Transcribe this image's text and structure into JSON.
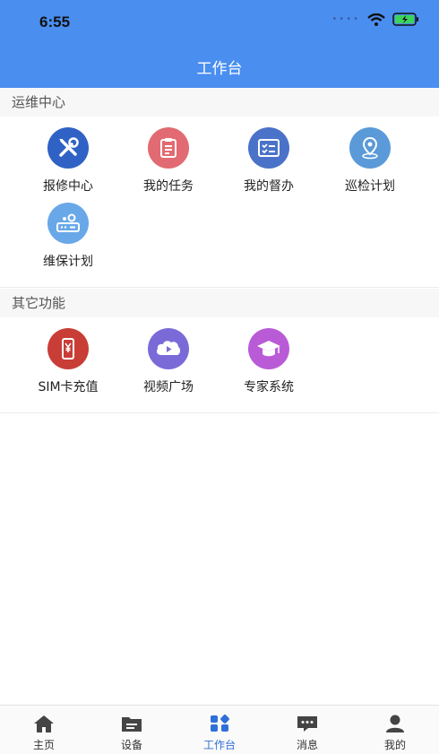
{
  "status_bar": {
    "time": "6:55"
  },
  "header": {
    "title": "工作台"
  },
  "sections": [
    {
      "title": "运维中心",
      "items": [
        {
          "label": "报修中心",
          "icon": "tools-icon",
          "color": "#2f62c4"
        },
        {
          "label": "我的任务",
          "icon": "clipboard-icon",
          "color": "#e26a72"
        },
        {
          "label": "我的督办",
          "icon": "checklist-icon",
          "color": "#4a72c8"
        },
        {
          "label": "巡检计划",
          "icon": "location-pin-icon",
          "color": "#5a9ad8"
        },
        {
          "label": "维保计划",
          "icon": "router-gear-icon",
          "color": "#69a8e8"
        }
      ]
    },
    {
      "title": "其它功能",
      "items": [
        {
          "label": "SIM卡充值",
          "icon": "phone-yuan-icon",
          "color": "#c83d36"
        },
        {
          "label": "视频广场",
          "icon": "video-play-icon",
          "color": "#7a6ad8"
        },
        {
          "label": "专家系统",
          "icon": "graduation-cap-icon",
          "color": "#b95bd6"
        }
      ]
    }
  ],
  "tabbar": {
    "items": [
      {
        "label": "主页",
        "icon": "home-icon"
      },
      {
        "label": "设备",
        "icon": "device-folder-icon"
      },
      {
        "label": "工作台",
        "icon": "grid-icon",
        "active": true
      },
      {
        "label": "消息",
        "icon": "message-icon"
      },
      {
        "label": "我的",
        "icon": "user-icon"
      }
    ],
    "active_color": "#2f6fd8"
  }
}
